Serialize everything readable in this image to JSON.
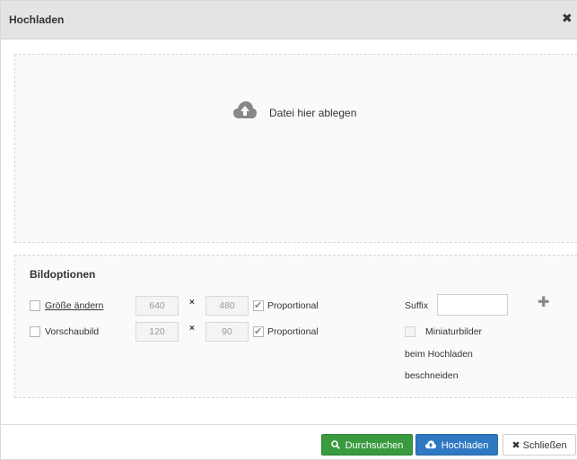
{
  "dialog": {
    "title": "Hochladen",
    "close_glyph": "✖"
  },
  "dropzone": {
    "icon": "cloud-upload-icon",
    "text": "Datei hier ablegen"
  },
  "options": {
    "title": "Bildoptionen",
    "resize": {
      "label": "Größe ändern",
      "checked": false,
      "width": "640",
      "height": "480",
      "proportional_label": "Proportional",
      "proportional_checked": true
    },
    "thumbnail": {
      "label": "Vorschaubild",
      "checked": false,
      "width": "120",
      "height": "90",
      "proportional_label": "Proportional",
      "proportional_checked": true
    },
    "times_glyph": "×",
    "check_glyph": "✔",
    "suffix": {
      "label": "Suffix",
      "value": ""
    },
    "add_glyph": "✚",
    "crop_thumbnails": {
      "label_line1": "Miniaturbilder",
      "label_line2": "beim Hochladen",
      "label_line3": "beschneiden",
      "checked": false
    }
  },
  "footer": {
    "browse_label": "Durchsuchen",
    "browse_icon": "search-icon",
    "upload_label": "Hochladen",
    "upload_icon": "cloud-upload-icon",
    "close_label": "Schließen",
    "close_icon": "close-icon",
    "search_glyph": "🔍",
    "x_glyph": "✖"
  },
  "colors": {
    "browse_button": "#3a9a3e",
    "upload_button": "#2f79c2",
    "titlebar": "#e4e4e4"
  }
}
